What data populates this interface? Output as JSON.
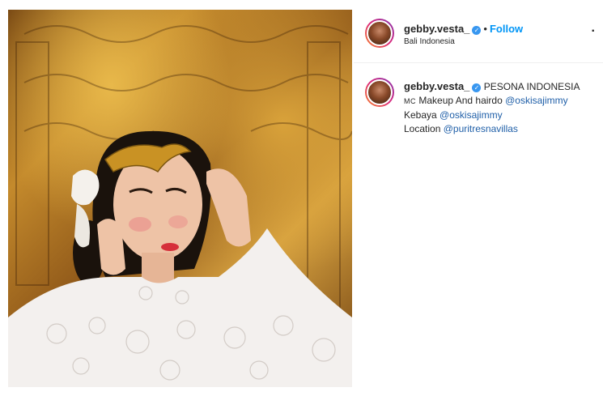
{
  "post": {
    "username": "gebby.vesta_",
    "follow_label": "Follow",
    "dot": "•",
    "location": "Bali Indonesia",
    "more": ".",
    "caption": {
      "username": "gebby.vesta_",
      "title": "PESONA INDONESIA",
      "mc_label": "MC",
      "makeup_text": "Makeup And hairdo",
      "makeup_mention": "@oskisajimmy",
      "kebaya_text": "Kebaya",
      "kebaya_mention": "@oskisajimmy",
      "location_text": "Location",
      "location_mention": "@puritresnavillas"
    }
  },
  "colors": {
    "follow": "#0095f6",
    "verified": "#3897f0",
    "mention": "#1f5fa8"
  }
}
